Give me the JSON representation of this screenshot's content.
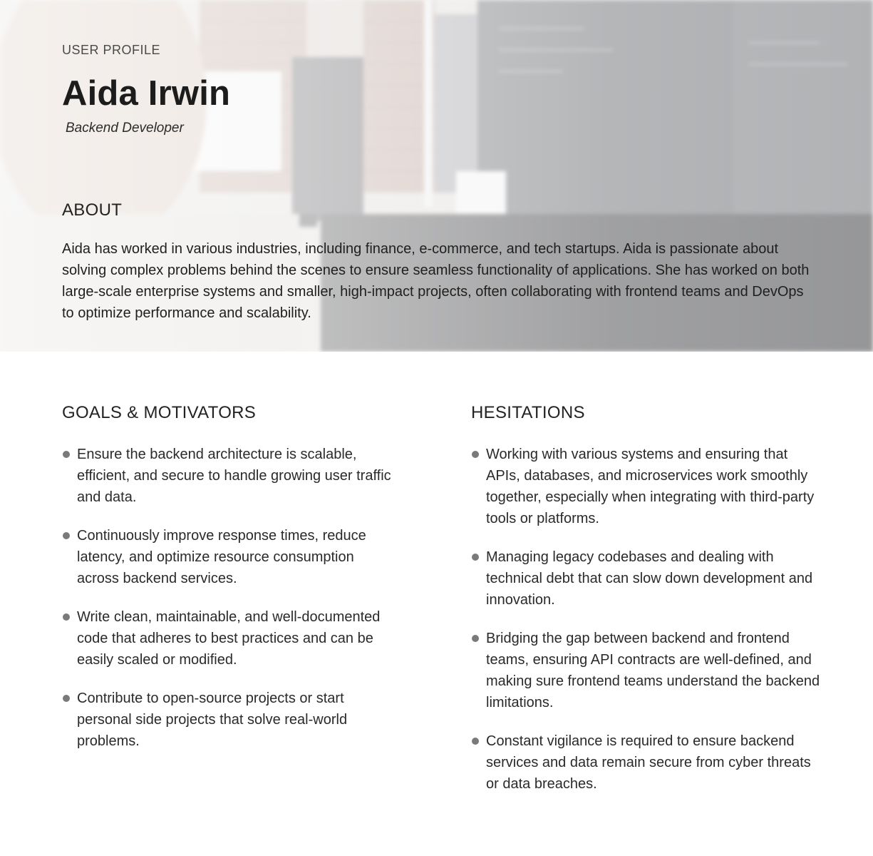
{
  "profile": {
    "eyebrow": "USER PROFILE",
    "name": "Aida Irwin",
    "role": "Backend Developer"
  },
  "about": {
    "heading": "ABOUT",
    "text": "Aida has worked in various industries, including finance, e-commerce, and tech startups. Aida is passionate about solving complex problems behind the scenes to ensure seamless functionality of applications. She has worked on both large-scale enterprise systems and smaller, high-impact projects, often collaborating with frontend teams and DevOps to optimize performance and scalability."
  },
  "goals": {
    "heading": "GOALS & MOTIVATORS",
    "items": [
      "Ensure the backend architecture is scalable, efficient, and secure to handle growing user traffic and data.",
      "Continuously improve response times, reduce latency, and optimize resource consumption across backend services.",
      "Write clean, maintainable, and well-documented code that adheres to best practices and can be easily scaled or modified.",
      "Contribute to open-source projects or start personal side projects that solve real-world problems."
    ]
  },
  "hesitations": {
    "heading": "HESITATIONS",
    "items": [
      "Working with various systems and ensuring that APIs, databases, and microservices work smoothly together, especially when integrating with third-party tools or platforms.",
      "Managing legacy codebases and dealing with technical debt that can slow down development and innovation.",
      "Bridging the gap between backend and frontend teams, ensuring API contracts are well-defined, and making sure frontend teams understand the backend limitations.",
      "Constant vigilance is required to ensure backend services and data remain secure from cyber threats or data breaches."
    ]
  },
  "colors": {
    "text_primary": "#1c1c1c",
    "bullet": "#7a7a7a",
    "background": "#ffffff"
  }
}
